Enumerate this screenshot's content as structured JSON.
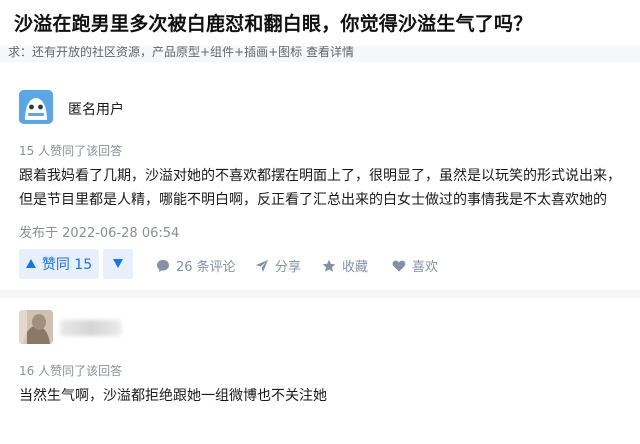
{
  "headline": {
    "title": "沙溢在跑男里多次被白鹿怼和翻白眼，你觉得沙溢生气了吗？"
  },
  "banner": {
    "text": "求：还有开放的社区资源，产品原型+组件+插画+图标 查看详情"
  },
  "answers": [
    {
      "author": "匿名用户",
      "upvote_note": "15 人赞同了该回答",
      "body_lines": [
        "跟着我妈看了几期，沙溢对她的不喜欢都摆在明面上了，很明显了，虽然是以玩笑的形式说出来，",
        "但是节目里都是人精，哪能不明白啊，反正看了汇总出来的白女士做过的事情我是不太喜欢她的"
      ],
      "published": "发布于 2022-06-28 06:54",
      "actions": {
        "upvote": "赞同 15",
        "comments": "26 条评论",
        "share": "分享",
        "favorite": "收藏",
        "like": "喜欢"
      },
      "icons": {
        "upvote": "triangle-up-icon",
        "downvote": "triangle-down-icon",
        "comments": "comment-bubble-icon",
        "share": "paper-plane-icon",
        "favorite": "star-icon",
        "like": "heart-icon"
      }
    },
    {
      "author": "",
      "upvote_note": "16 人赞同了该回答",
      "body_lines": [
        "当然生气啊，沙溢都拒绝跟她一组微博也不关注她"
      ]
    }
  ],
  "colors": {
    "accent": "#1772f6",
    "accent_bg": "#e8f0fd",
    "muted": "#8590a6"
  }
}
